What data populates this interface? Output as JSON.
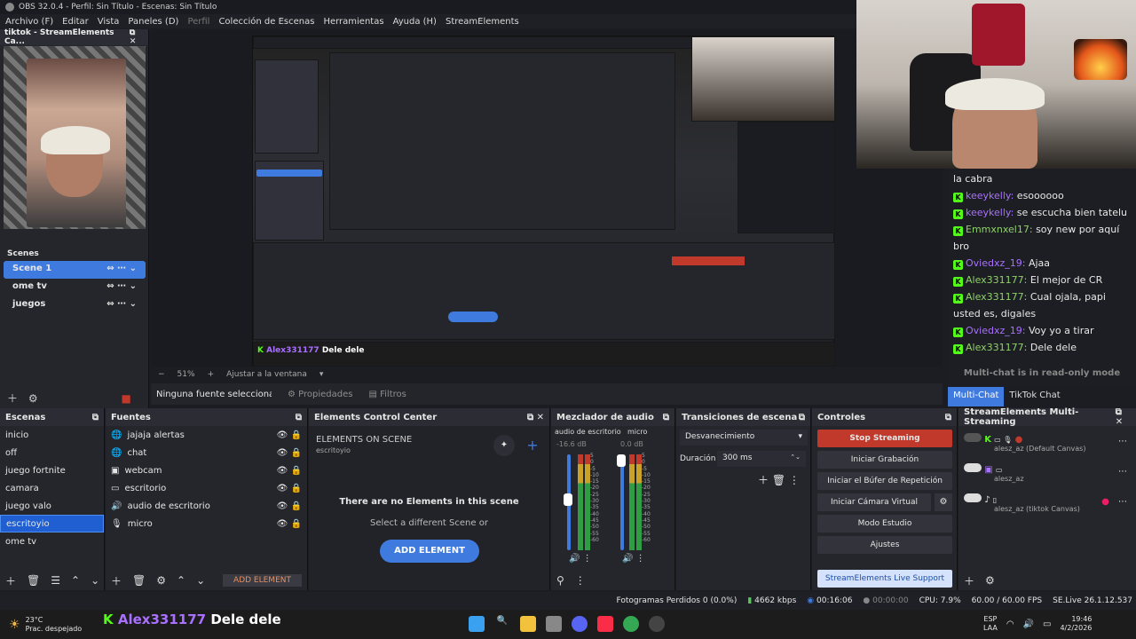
{
  "window": {
    "title": "OBS 32.0.4 - Perfil: Sin Título - Escenas: Sin Título"
  },
  "menu": [
    "Archivo (F)",
    "Editar",
    "Vista",
    "Paneles (D)",
    "Perfil",
    "Colección de Escenas",
    "Herramientas",
    "Ayuda (H)",
    "StreamElements"
  ],
  "left_dock": {
    "title": "tiktok - StreamElements Ca...",
    "scenes_title": "Scenes",
    "scenes": [
      "Scene 1",
      "ome tv",
      "juegos"
    ]
  },
  "preview": {
    "zoom": "51%",
    "fit": "Ajustar a la ventana",
    "no_source": "Ninguna fuente seleccionada",
    "properties": "Propiedades",
    "filters": "Filtros"
  },
  "overlay": {
    "user": "Alex331177",
    "message": "Dele dele"
  },
  "chat": {
    "lines": [
      {
        "user": "",
        "text": "la cabra"
      },
      {
        "user": "keeykelly:",
        "text": "esoooooo"
      },
      {
        "user": "keeykelly:",
        "text": "se escucha bien tatelu"
      },
      {
        "user": "Emmxnxel17:",
        "text": "soy new por aquí bro"
      },
      {
        "user": "Oviedxz_19:",
        "text": "Ajaa"
      },
      {
        "user": "Alex331177:",
        "text": "El mejor de CR"
      },
      {
        "user": "Alex331177:",
        "text": "Cual ojala, papi usted es, digales"
      },
      {
        "user": "Oviedxz_19:",
        "text": "Voy yo a tirar"
      },
      {
        "user": "Alex331177:",
        "text": "Dele dele"
      }
    ],
    "readonly": "Multi-chat is in read-only mode",
    "tabs": [
      "Multi-Chat",
      "TikTok Chat"
    ]
  },
  "escenas": {
    "title": "Escenas",
    "items": [
      "inicio",
      "off",
      "juego fortnite",
      "camara",
      "juego valo",
      "escritoyio",
      "ome tv"
    ],
    "selected": 5
  },
  "fuentes": {
    "title": "Fuentes",
    "items": [
      "jajaja alertas",
      "chat",
      "webcam",
      "escritorio",
      "audio de escritorio",
      "micro"
    ],
    "add": "ADD ELEMENT"
  },
  "ecc": {
    "title": "Elements Control Center",
    "on_scene": "ELEMENTS ON SCENE",
    "scene": "escritoyio",
    "empty": "There are no Elements in this scene",
    "hint": "Select a different Scene or",
    "add": "ADD ELEMENT"
  },
  "mixer": {
    "title": "Mezclador de audio",
    "channels": [
      {
        "name": "audio de escritorio",
        "db": "-16.6 dB"
      },
      {
        "name": "micro",
        "db": "0.0 dB"
      }
    ],
    "scale": [
      "5",
      "0",
      "-5",
      "-10",
      "-15",
      "-20",
      "-25",
      "-30",
      "-35",
      "-40",
      "-45",
      "-50",
      "-55",
      "-60"
    ]
  },
  "transitions": {
    "title": "Transiciones de escena",
    "type": "Desvanecimiento",
    "duration_label": "Duración",
    "duration": "300 ms"
  },
  "controls": {
    "title": "Controles",
    "buttons": [
      "Stop Streaming",
      "Iniciar Grabación",
      "Iniciar el Búfer de Repetición",
      "Iniciar Cámara Virtual",
      "Modo Estudio",
      "Ajustes"
    ],
    "support": "StreamElements Live Support"
  },
  "multistream": {
    "title": "StreamElements Multi-Streaming",
    "accounts": [
      "alesz_az (Default Canvas)",
      "alesz_az",
      "alesz_az (tiktok Canvas)"
    ]
  },
  "status": {
    "dropped": "Fotogramas Perdidos 0 (0.0%)",
    "kbps": "4662 kbps",
    "live_time": "00:16:06",
    "rec_time": "00:00:00",
    "cpu": "CPU: 7.9%",
    "fps": "60.00 / 60.00 FPS",
    "version": "SE.Live 26.1.12.537"
  },
  "taskbar": {
    "weather_temp": "23°C",
    "weather_desc": "Prac. despejado",
    "lang": "ESP",
    "region": "LAA",
    "time": "19:46",
    "date": "4/2/2026"
  },
  "colors": {
    "accent": "#3f7adf",
    "stop": "#c0392b",
    "kick": "#53fc18"
  }
}
